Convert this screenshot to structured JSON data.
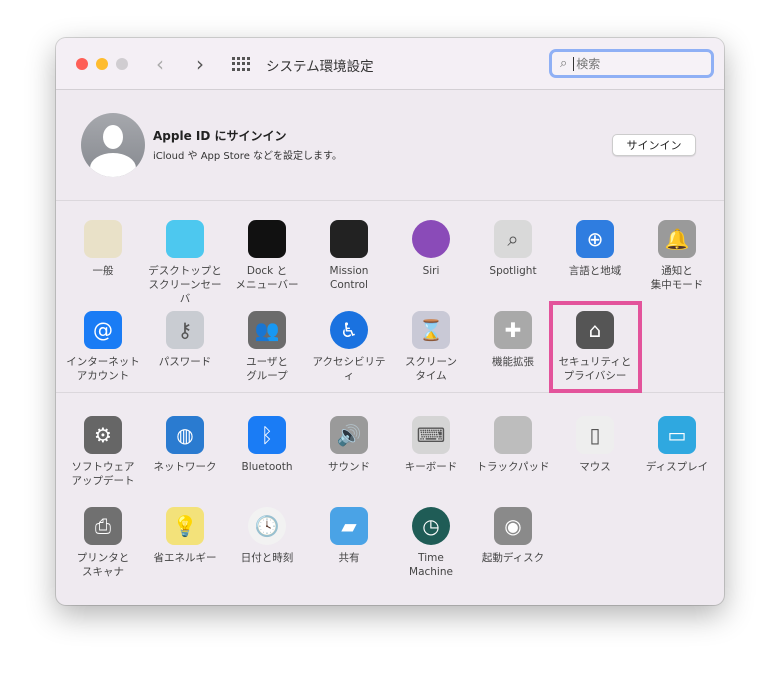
{
  "window": {
    "title": "システム環境設定",
    "search_placeholder": "検索"
  },
  "account": {
    "title": "Apple ID にサインイン",
    "subtitle": "iCloud や App Store などを設定します。",
    "signin_label": "サインイン"
  },
  "section1": [
    {
      "label": "一般",
      "icon": "general-icon",
      "color": "#e9e1c8"
    },
    {
      "label": "デスクトップと\nスクリーンセーバ",
      "icon": "desktop-icon",
      "color": "#4dc8ef"
    },
    {
      "label": "Dock と\nメニューバー",
      "icon": "dock-icon",
      "color": "#111111"
    },
    {
      "label": "Mission\nControl",
      "icon": "mission-control-icon",
      "color": "#222222"
    },
    {
      "label": "Siri",
      "icon": "siri-icon",
      "color": "#8a4bb8"
    },
    {
      "label": "Spotlight",
      "icon": "spotlight-icon",
      "color": "#d9d9d9"
    },
    {
      "label": "言語と地域",
      "icon": "globe-flag-icon",
      "color": "#2f7de0"
    },
    {
      "label": "通知と\n集中モード",
      "icon": "bell-icon",
      "color": "#9a9a9a"
    },
    {
      "label": "インターネット\nアカウント",
      "icon": "at-icon",
      "color": "#1a7cf5"
    },
    {
      "label": "パスワード",
      "icon": "key-icon",
      "color": "#c9ccd2"
    },
    {
      "label": "ユーザと\nグループ",
      "icon": "users-icon",
      "color": "#6b6b6b"
    },
    {
      "label": "アクセシビリティ",
      "icon": "accessibility-icon",
      "color": "#1a72e0"
    },
    {
      "label": "スクリーン\nタイム",
      "icon": "hourglass-icon",
      "color": "#c9c9d6"
    },
    {
      "label": "機能拡張",
      "icon": "puzzle-icon",
      "color": "#a9a9a9"
    },
    {
      "label": "セキュリティと\nプライバシー",
      "icon": "security-house-icon",
      "color": "#555555"
    }
  ],
  "section2": [
    {
      "label": "ソフトウェア\nアップデート",
      "icon": "gear-icon",
      "color": "#666666"
    },
    {
      "label": "ネットワーク",
      "icon": "network-globe-icon",
      "color": "#2a7bd0"
    },
    {
      "label": "Bluetooth",
      "icon": "bluetooth-icon",
      "color": "#1a7cf5"
    },
    {
      "label": "サウンド",
      "icon": "speaker-icon",
      "color": "#9a9a9a"
    },
    {
      "label": "キーボード",
      "icon": "keyboard-icon",
      "color": "#d5d5d5"
    },
    {
      "label": "トラックパッド",
      "icon": "trackpad-icon",
      "color": "#bdbdbd"
    },
    {
      "label": "マウス",
      "icon": "mouse-icon",
      "color": "#eeeeee"
    },
    {
      "label": "ディスプレイ",
      "icon": "display-icon",
      "color": "#2fa8e0"
    },
    {
      "label": "プリンタと\nスキャナ",
      "icon": "printer-icon",
      "color": "#707070"
    },
    {
      "label": "省エネルギー",
      "icon": "lightbulb-icon",
      "color": "#f3e27a"
    },
    {
      "label": "日付と時刻",
      "icon": "clock-icon",
      "color": "#f2f2f2"
    },
    {
      "label": "共有",
      "icon": "folder-icon",
      "color": "#4aa3e6"
    },
    {
      "label": "Time\nMachine",
      "icon": "time-machine-icon",
      "color": "#1f5c56"
    },
    {
      "label": "起動ディスク",
      "icon": "disk-icon",
      "color": "#8a8a8a"
    }
  ],
  "highlight_color": "#e3539b"
}
